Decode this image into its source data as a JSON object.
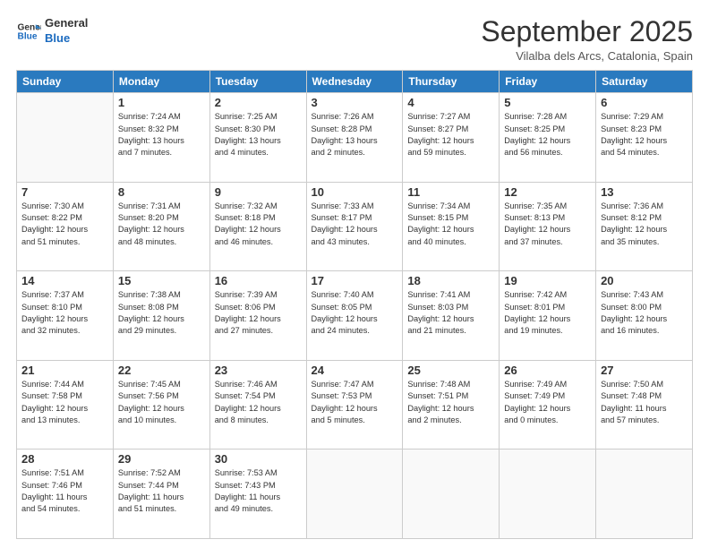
{
  "logo": {
    "line1": "General",
    "line2": "Blue"
  },
  "title": "September 2025",
  "location": "Vilalba dels Arcs, Catalonia, Spain",
  "days_of_week": [
    "Sunday",
    "Monday",
    "Tuesday",
    "Wednesday",
    "Thursday",
    "Friday",
    "Saturday"
  ],
  "weeks": [
    [
      {
        "day": "",
        "info": ""
      },
      {
        "day": "1",
        "info": "Sunrise: 7:24 AM\nSunset: 8:32 PM\nDaylight: 13 hours\nand 7 minutes."
      },
      {
        "day": "2",
        "info": "Sunrise: 7:25 AM\nSunset: 8:30 PM\nDaylight: 13 hours\nand 4 minutes."
      },
      {
        "day": "3",
        "info": "Sunrise: 7:26 AM\nSunset: 8:28 PM\nDaylight: 13 hours\nand 2 minutes."
      },
      {
        "day": "4",
        "info": "Sunrise: 7:27 AM\nSunset: 8:27 PM\nDaylight: 12 hours\nand 59 minutes."
      },
      {
        "day": "5",
        "info": "Sunrise: 7:28 AM\nSunset: 8:25 PM\nDaylight: 12 hours\nand 56 minutes."
      },
      {
        "day": "6",
        "info": "Sunrise: 7:29 AM\nSunset: 8:23 PM\nDaylight: 12 hours\nand 54 minutes."
      }
    ],
    [
      {
        "day": "7",
        "info": "Sunrise: 7:30 AM\nSunset: 8:22 PM\nDaylight: 12 hours\nand 51 minutes."
      },
      {
        "day": "8",
        "info": "Sunrise: 7:31 AM\nSunset: 8:20 PM\nDaylight: 12 hours\nand 48 minutes."
      },
      {
        "day": "9",
        "info": "Sunrise: 7:32 AM\nSunset: 8:18 PM\nDaylight: 12 hours\nand 46 minutes."
      },
      {
        "day": "10",
        "info": "Sunrise: 7:33 AM\nSunset: 8:17 PM\nDaylight: 12 hours\nand 43 minutes."
      },
      {
        "day": "11",
        "info": "Sunrise: 7:34 AM\nSunset: 8:15 PM\nDaylight: 12 hours\nand 40 minutes."
      },
      {
        "day": "12",
        "info": "Sunrise: 7:35 AM\nSunset: 8:13 PM\nDaylight: 12 hours\nand 37 minutes."
      },
      {
        "day": "13",
        "info": "Sunrise: 7:36 AM\nSunset: 8:12 PM\nDaylight: 12 hours\nand 35 minutes."
      }
    ],
    [
      {
        "day": "14",
        "info": "Sunrise: 7:37 AM\nSunset: 8:10 PM\nDaylight: 12 hours\nand 32 minutes."
      },
      {
        "day": "15",
        "info": "Sunrise: 7:38 AM\nSunset: 8:08 PM\nDaylight: 12 hours\nand 29 minutes."
      },
      {
        "day": "16",
        "info": "Sunrise: 7:39 AM\nSunset: 8:06 PM\nDaylight: 12 hours\nand 27 minutes."
      },
      {
        "day": "17",
        "info": "Sunrise: 7:40 AM\nSunset: 8:05 PM\nDaylight: 12 hours\nand 24 minutes."
      },
      {
        "day": "18",
        "info": "Sunrise: 7:41 AM\nSunset: 8:03 PM\nDaylight: 12 hours\nand 21 minutes."
      },
      {
        "day": "19",
        "info": "Sunrise: 7:42 AM\nSunset: 8:01 PM\nDaylight: 12 hours\nand 19 minutes."
      },
      {
        "day": "20",
        "info": "Sunrise: 7:43 AM\nSunset: 8:00 PM\nDaylight: 12 hours\nand 16 minutes."
      }
    ],
    [
      {
        "day": "21",
        "info": "Sunrise: 7:44 AM\nSunset: 7:58 PM\nDaylight: 12 hours\nand 13 minutes."
      },
      {
        "day": "22",
        "info": "Sunrise: 7:45 AM\nSunset: 7:56 PM\nDaylight: 12 hours\nand 10 minutes."
      },
      {
        "day": "23",
        "info": "Sunrise: 7:46 AM\nSunset: 7:54 PM\nDaylight: 12 hours\nand 8 minutes."
      },
      {
        "day": "24",
        "info": "Sunrise: 7:47 AM\nSunset: 7:53 PM\nDaylight: 12 hours\nand 5 minutes."
      },
      {
        "day": "25",
        "info": "Sunrise: 7:48 AM\nSunset: 7:51 PM\nDaylight: 12 hours\nand 2 minutes."
      },
      {
        "day": "26",
        "info": "Sunrise: 7:49 AM\nSunset: 7:49 PM\nDaylight: 12 hours\nand 0 minutes."
      },
      {
        "day": "27",
        "info": "Sunrise: 7:50 AM\nSunset: 7:48 PM\nDaylight: 11 hours\nand 57 minutes."
      }
    ],
    [
      {
        "day": "28",
        "info": "Sunrise: 7:51 AM\nSunset: 7:46 PM\nDaylight: 11 hours\nand 54 minutes."
      },
      {
        "day": "29",
        "info": "Sunrise: 7:52 AM\nSunset: 7:44 PM\nDaylight: 11 hours\nand 51 minutes."
      },
      {
        "day": "30",
        "info": "Sunrise: 7:53 AM\nSunset: 7:43 PM\nDaylight: 11 hours\nand 49 minutes."
      },
      {
        "day": "",
        "info": ""
      },
      {
        "day": "",
        "info": ""
      },
      {
        "day": "",
        "info": ""
      },
      {
        "day": "",
        "info": ""
      }
    ]
  ]
}
